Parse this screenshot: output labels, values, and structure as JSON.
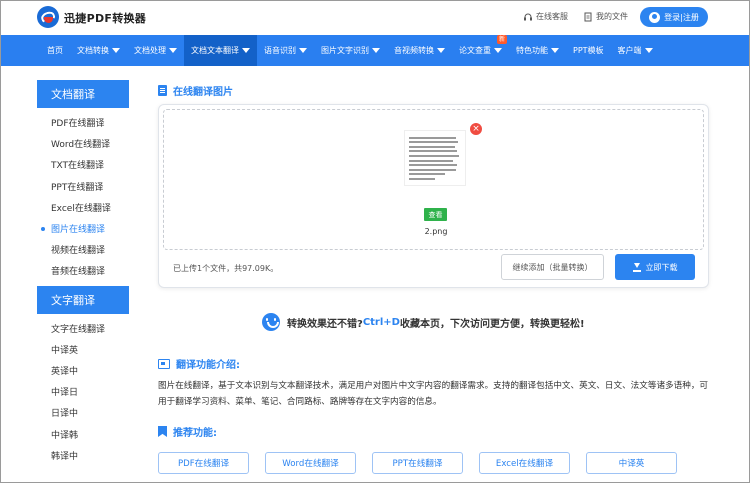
{
  "header": {
    "brand": "迅捷PDF转换器",
    "service": "在线客服",
    "my_files": "我的文件",
    "login": "登录|注册"
  },
  "nav": {
    "items": [
      {
        "label": "首页",
        "caret": false
      },
      {
        "label": "文档转换",
        "caret": true
      },
      {
        "label": "文档处理",
        "caret": true
      },
      {
        "label": "文档文本翻译",
        "caret": true,
        "active": true
      },
      {
        "label": "语音识别",
        "caret": true
      },
      {
        "label": "图片文字识别",
        "caret": true
      },
      {
        "label": "音视频转换",
        "caret": true
      },
      {
        "label": "论文查重",
        "caret": true,
        "badge": "新"
      },
      {
        "label": "特色功能",
        "caret": true
      },
      {
        "label": "PPT模板",
        "caret": false
      },
      {
        "label": "客户端",
        "caret": true
      }
    ]
  },
  "sidebar": {
    "sections": [
      {
        "title": "文档翻译",
        "items": [
          "PDF在线翻译",
          "Word在线翻译",
          "TXT在线翻译",
          "PPT在线翻译",
          "Excel在线翻译",
          "图片在线翻译",
          "视频在线翻译",
          "音频在线翻译"
        ]
      },
      {
        "title": "文字翻译",
        "items": [
          "文字在线翻译",
          "中译英",
          "英译中",
          "中译日",
          "日译中",
          "中译韩",
          "韩译中"
        ]
      }
    ]
  },
  "main": {
    "title": "在线翻译图片",
    "file": {
      "name": "2.png",
      "view": "查看"
    },
    "status": "已上传1个文件，共97.09K。",
    "add_more": "继续添加（批量转换）",
    "download": "立即下载",
    "promo_before": "转换效果还不错?",
    "promo_keys": "Ctrl+D",
    "promo_after": "收藏本页，下次访问更方便，转换更轻松!",
    "intro_title": "翻译功能介绍:",
    "intro_text": "图片在线翻译，基于文本识别与文本翻译技术，满足用户对图片中文字内容的翻译需求。支持的翻译包括中文、英文、日文、法文等诸多语种，可用于翻译学习资料、菜单、笔记、合同路标、路牌等存在文字内容的信息。",
    "rec_title": "推荐功能:",
    "recommend": [
      "PDF在线翻译",
      "Word在线翻译",
      "PPT在线翻译",
      "Excel在线翻译",
      "中译英"
    ]
  },
  "colors": {
    "accent": "#2c84f0",
    "nav_bg": "#2a7ff0",
    "nav_active": "#1361c8",
    "view_btn": "#2fb24b",
    "delete": "#f04c41"
  }
}
